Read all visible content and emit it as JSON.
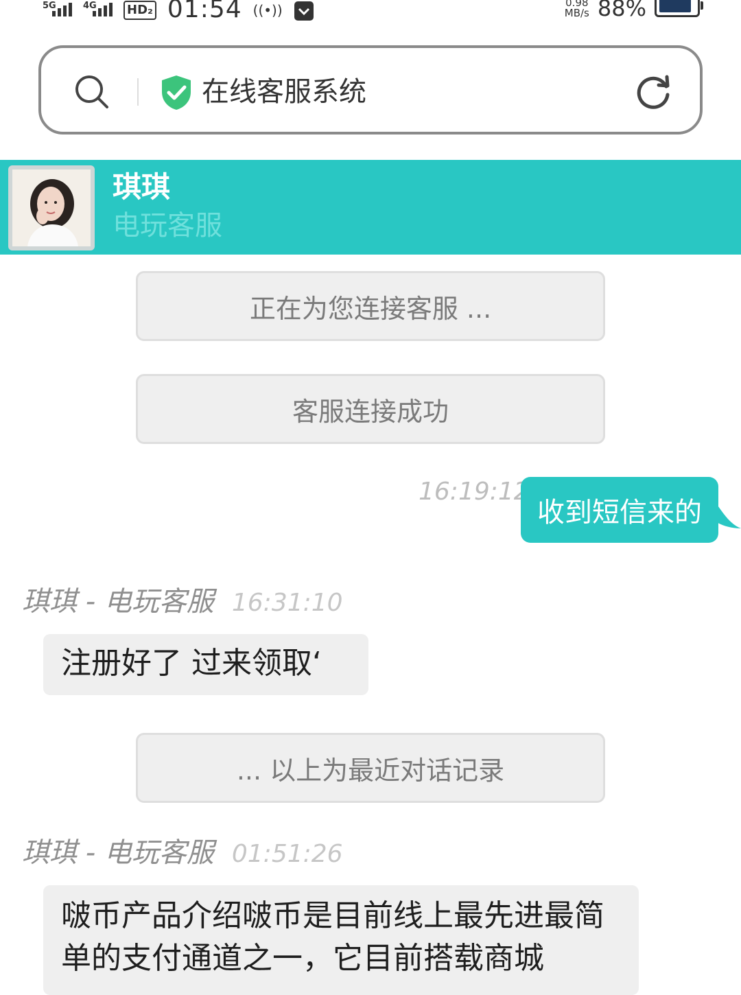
{
  "status_bar": {
    "signal1_tag": "5G",
    "signal2_tag": "4G",
    "hd_label": "HD₂",
    "time": "01:54",
    "extra_icon": "((•))",
    "net_speed_value": "0.98",
    "net_speed_unit": "MB/s",
    "battery_percent": "88%",
    "battery_level": 0.88,
    "icons": [
      "signal-5g-icon",
      "signal-4g-icon",
      "hd-voice-icon",
      "hotspot-icon",
      "app-notification-icon",
      "battery-icon"
    ]
  },
  "address_bar": {
    "title": "在线客服系统",
    "icons": [
      "search-icon",
      "shield-check-icon",
      "refresh-icon"
    ],
    "shield_color": "#3cc47c"
  },
  "agent": {
    "name": "琪琪",
    "role": "电玩客服",
    "header_color": "#29c7c3"
  },
  "chat": {
    "system_connecting": "正在为您连接客服 ...",
    "system_connected": "客服连接成功",
    "outgoing": {
      "time": "16:19:12",
      "text": "收到短信来的"
    },
    "incoming1": {
      "sender": "琪琪 - 电玩客服",
      "time": "16:31:10",
      "text": "注册好了 过来领取‘"
    },
    "system_history": "... 以上为最近对话记录",
    "incoming2": {
      "sender": "琪琪 - 电玩客服",
      "time": "01:51:26",
      "text": "啵币产品介绍啵币是目前线上最先进最简单的支付通道之一，它目前搭载商城"
    }
  }
}
